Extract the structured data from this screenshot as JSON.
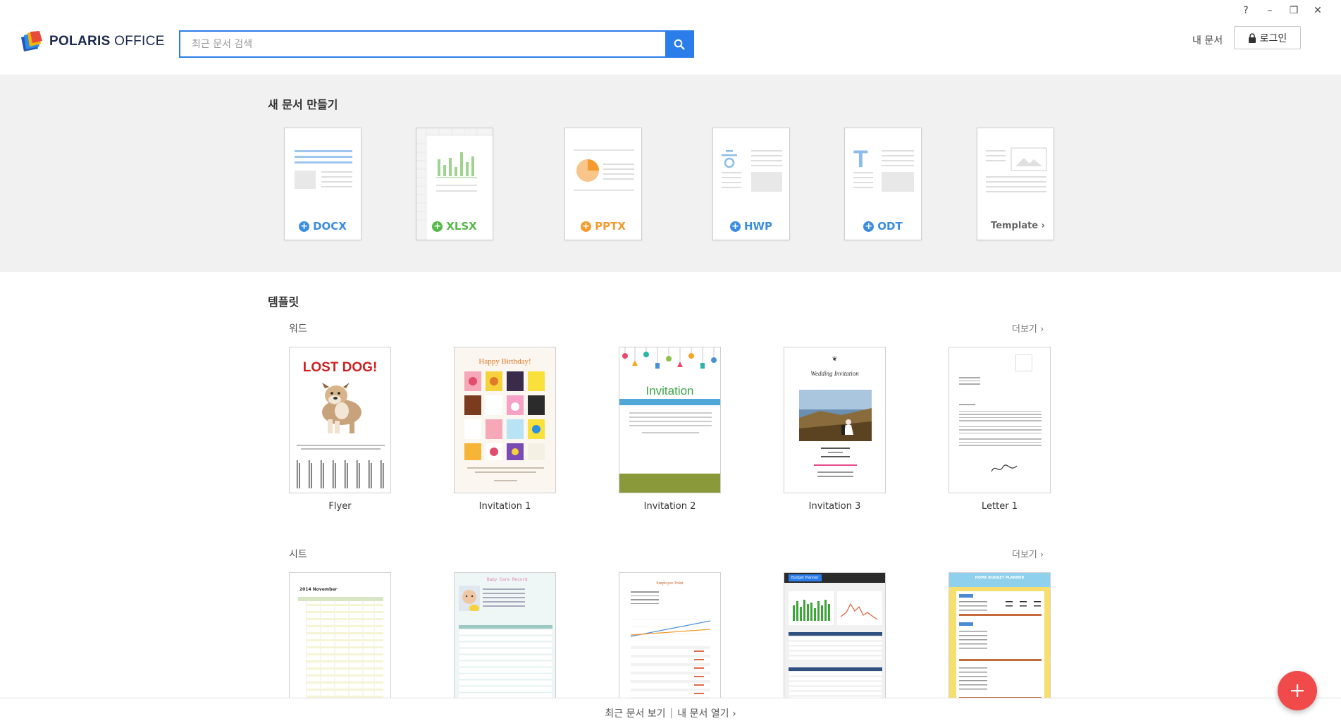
{
  "window": {
    "help": "?",
    "minimize": "–",
    "restore": "❐",
    "close": "✕"
  },
  "header": {
    "logo_text_bold": "POLARIS",
    "logo_text_light": "OFFICE",
    "search_placeholder": "최근 문서 검색",
    "my_docs": "내 문서",
    "login": "로그인"
  },
  "new_doc": {
    "title": "새 문서 만들기",
    "cards": [
      {
        "label": "DOCX",
        "color": "#3b8de0"
      },
      {
        "label": "XLSX",
        "color": "#56b848"
      },
      {
        "label": "PPTX",
        "color": "#f39b2e"
      },
      {
        "label": "HWP",
        "color": "#3b8de0"
      },
      {
        "label": "ODT",
        "color": "#3b8de0"
      },
      {
        "label": "Template ›",
        "color": "#666666"
      }
    ]
  },
  "templates": {
    "title": "템플릿",
    "word": {
      "title": "워드",
      "more": "더보기 ›",
      "items": [
        {
          "name": "Flyer",
          "heading": "LOST DOG!"
        },
        {
          "name": "Invitation 1",
          "heading": "Happy Birthday!"
        },
        {
          "name": "Invitation 2",
          "heading": "Invitation"
        },
        {
          "name": "Invitation 3",
          "heading": "Wedding Invitation"
        },
        {
          "name": "Letter 1",
          "heading": ""
        }
      ]
    },
    "sheet": {
      "title": "시트",
      "more": "더보기 ›",
      "items": [
        {
          "heading": "2014 November"
        },
        {
          "heading": "Baby Care Record"
        },
        {
          "heading": "Employee Point"
        },
        {
          "heading": "Budget Planner"
        },
        {
          "heading": "HOME BUDGET PLANNER"
        }
      ]
    }
  },
  "bottom": {
    "recent": "최근 문서 보기",
    "separator": "|",
    "open": "내 문서 열기 ›"
  },
  "colors": {
    "accent": "#2b7de9",
    "fab": "#f04a4a"
  }
}
